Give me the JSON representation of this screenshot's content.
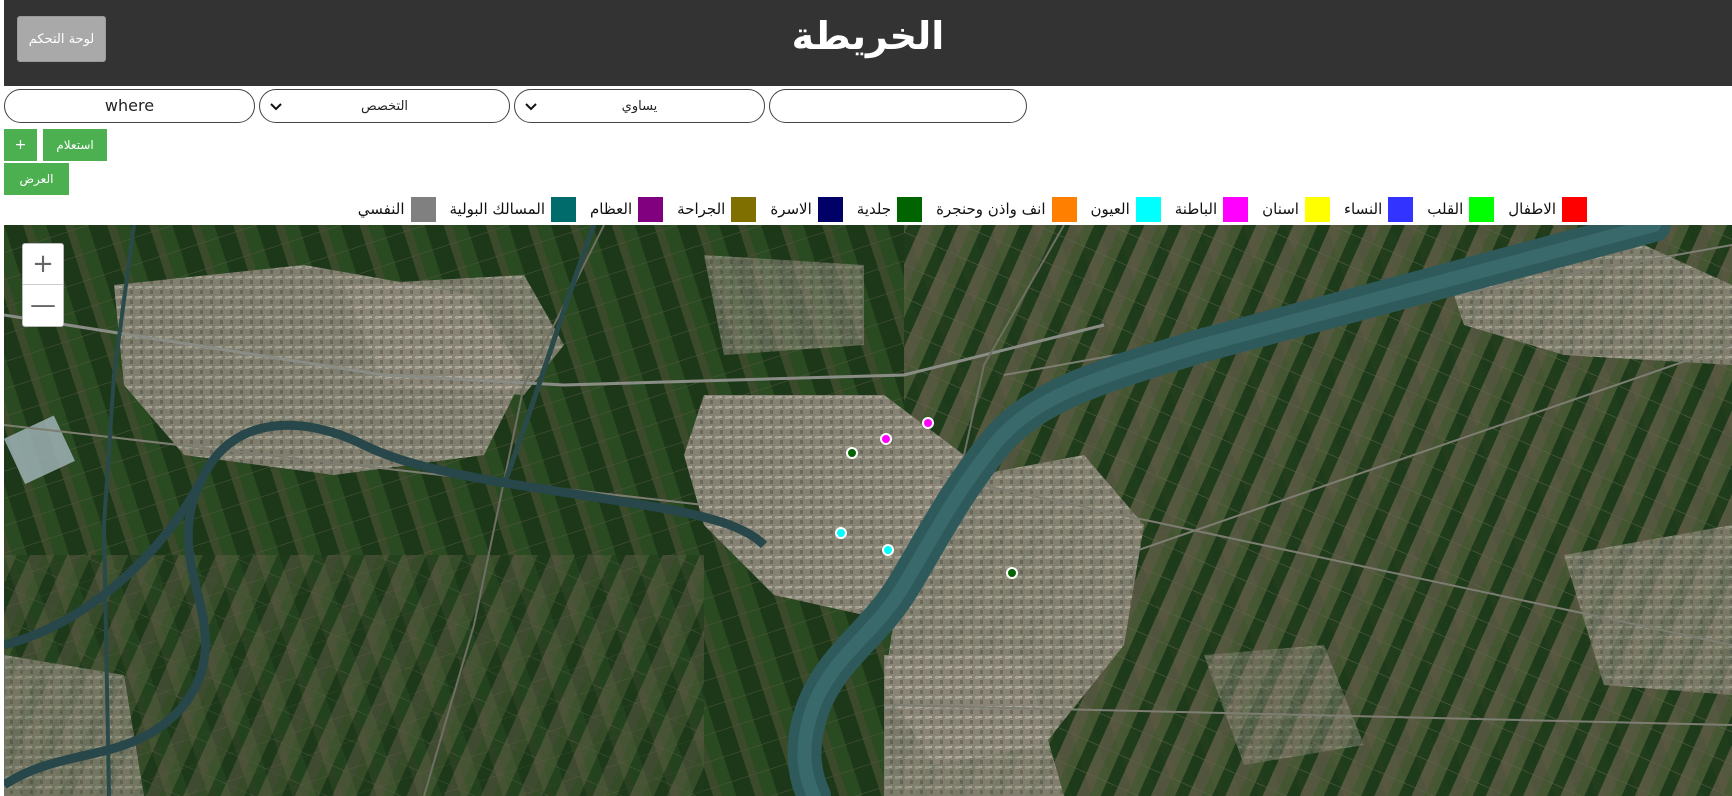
{
  "header": {
    "title": "الخريطة",
    "dashboard_button": "لوحة التحكم"
  },
  "filters": {
    "where_value": "where",
    "specialty_select": "التخصص",
    "operator_select": "يساوي",
    "value_input": ""
  },
  "buttons": {
    "add": "+",
    "query": "استعلام",
    "show": "العرض"
  },
  "legend": [
    {
      "label": "الاطفال",
      "color": "#ff0000"
    },
    {
      "label": "القلب",
      "color": "#00ff00"
    },
    {
      "label": "النساء",
      "color": "#3333ff"
    },
    {
      "label": "اسنان",
      "color": "#ffff00"
    },
    {
      "label": "الباطنة",
      "color": "#ff00ff"
    },
    {
      "label": "العيون",
      "color": "#00ffff"
    },
    {
      "label": "انف واذن وحنجرة",
      "color": "#ff7f00"
    },
    {
      "label": "جلدية",
      "color": "#006400"
    },
    {
      "label": "الاسرة",
      "color": "#000066"
    },
    {
      "label": "الجراحة",
      "color": "#7f6f00"
    },
    {
      "label": "العظام",
      "color": "#800080"
    },
    {
      "label": "المسالك البولية",
      "color": "#006b6b"
    },
    {
      "label": "النفسي",
      "color": "#808080"
    }
  ],
  "map": {
    "zoom_in": "+",
    "zoom_out": "—",
    "markers": [
      {
        "specialty": "الباطنة",
        "color": "#ff00ff"
      },
      {
        "specialty": "الباطنة",
        "color": "#ff00ff"
      },
      {
        "specialty": "جلدية",
        "color": "#006400"
      },
      {
        "specialty": "العيون",
        "color": "#00ffff"
      },
      {
        "specialty": "العيون",
        "color": "#00ffff"
      },
      {
        "specialty": "جلدية",
        "color": "#006400"
      }
    ]
  }
}
